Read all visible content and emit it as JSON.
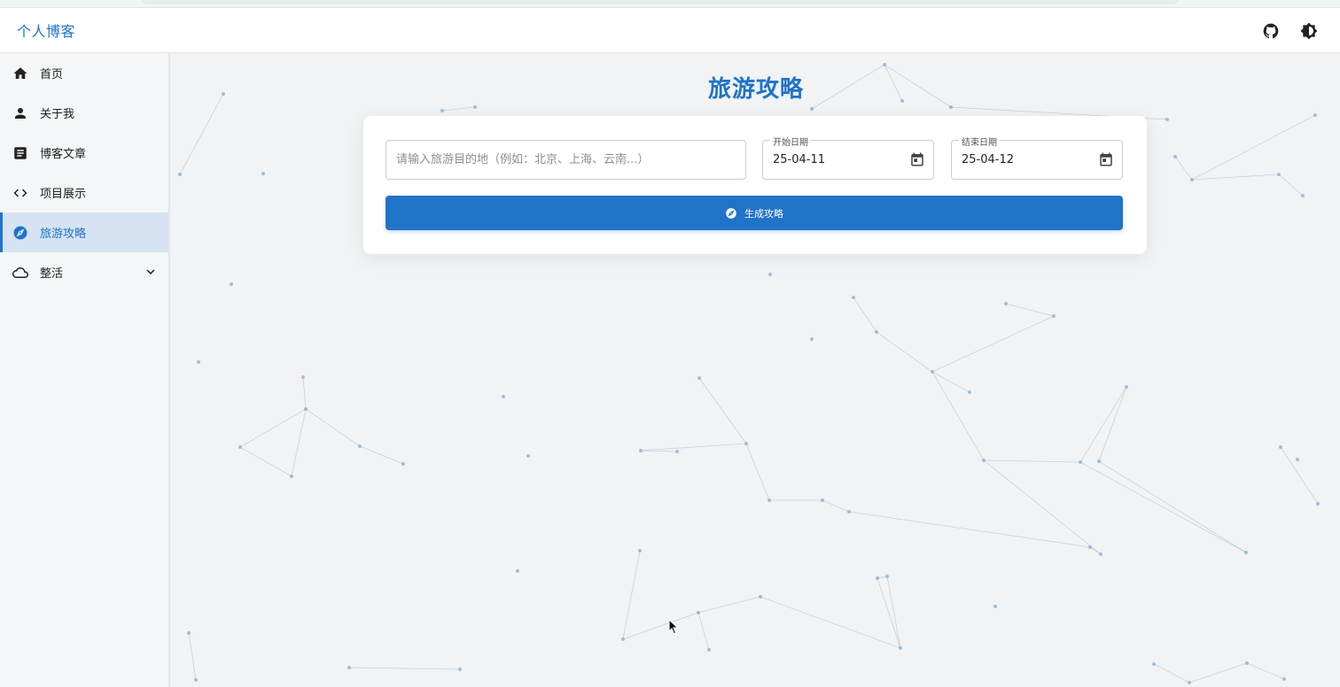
{
  "app": {
    "brand": "个人博客"
  },
  "header": {
    "icons": [
      "github-icon",
      "theme-toggle-icon"
    ]
  },
  "sidebar": {
    "items": [
      {
        "label": "首页",
        "icon": "home-icon",
        "active": false
      },
      {
        "label": "关于我",
        "icon": "person-icon",
        "active": false
      },
      {
        "label": "博客文章",
        "icon": "article-icon",
        "active": false
      },
      {
        "label": "项目展示",
        "icon": "code-icon",
        "active": false
      },
      {
        "label": "旅游攻略",
        "icon": "compass-icon",
        "active": true
      },
      {
        "label": "整活",
        "icon": "cloud-icon",
        "active": false,
        "expandable": true
      }
    ]
  },
  "main": {
    "title": "旅游攻略",
    "form": {
      "destination_placeholder": "请输入旅游目的地（例如：北京、上海、云南...）",
      "destination_value": "",
      "start_label": "开始日期",
      "start_value": "25-04-11",
      "end_label": "结束日期",
      "end_value": "25-04-12",
      "submit_label": "生成攻略"
    }
  },
  "colors": {
    "accent": "#1f73c9",
    "active_bg": "#d5e3f2",
    "background": "#f1f3f4"
  }
}
